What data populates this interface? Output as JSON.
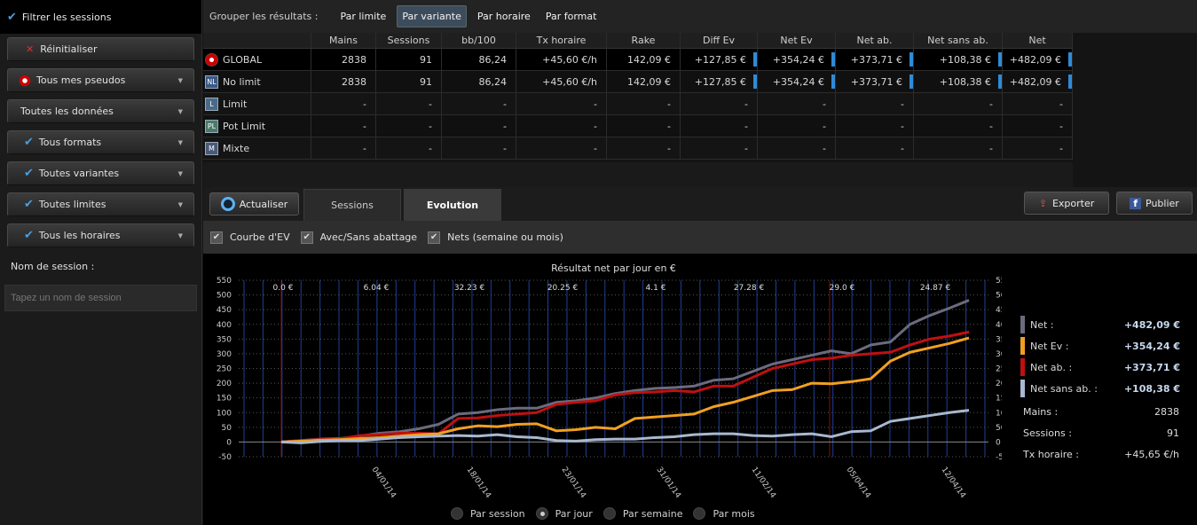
{
  "sidebar": {
    "header": "Filtrer les sessions",
    "reset": "Réinitialiser",
    "pseudos": "Tous mes pseudos",
    "data": "Toutes les données",
    "formats": "Tous formats",
    "variants": "Toutes variantes",
    "limits": "Toutes limites",
    "hours": "Tous les horaires",
    "session_name_label": "Nom de session :",
    "session_name_placeholder": "Tapez un nom de session"
  },
  "groupbar": {
    "label": "Grouper les résultats :",
    "items": [
      "Par limite",
      "Par variante",
      "Par horaire",
      "Par format"
    ],
    "active": "Par variante"
  },
  "table": {
    "headers": [
      "",
      "Mains",
      "Sessions",
      "bb/100",
      "Tx horaire",
      "Rake",
      "Diff Ev",
      "Net Ev",
      "Net ab.",
      "Net sans ab.",
      "Net"
    ],
    "rows": [
      {
        "badge": "",
        "name": "GLOBAL",
        "cells": [
          "2838",
          "91",
          "86,24",
          "+45,60 €/h",
          "142,09 €",
          "+127,85 €",
          "+354,24 €",
          "+373,71 €",
          "+108,38 €",
          "+482,09 €"
        ]
      },
      {
        "badge": "NL",
        "name": "No limit",
        "cells": [
          "2838",
          "91",
          "86,24",
          "+45,60 €/h",
          "142,09 €",
          "+127,85 €",
          "+354,24 €",
          "+373,71 €",
          "+108,38 €",
          "+482,09 €"
        ]
      },
      {
        "badge": "L",
        "name": "Limit",
        "cells": [
          "-",
          "-",
          "-",
          "-",
          "-",
          "-",
          "-",
          "-",
          "-",
          "-"
        ]
      },
      {
        "badge": "PL",
        "name": "Pot Limit",
        "cells": [
          "-",
          "-",
          "-",
          "-",
          "-",
          "-",
          "-",
          "-",
          "-",
          "-"
        ]
      },
      {
        "badge": "M",
        "name": "Mixte",
        "cells": [
          "-",
          "-",
          "-",
          "-",
          "-",
          "-",
          "-",
          "-",
          "-",
          "-"
        ]
      }
    ]
  },
  "toolbar": {
    "refresh": "Actualiser",
    "tab_sessions": "Sessions",
    "tab_evolution": "Evolution",
    "export": "Exporter",
    "publish": "Publier"
  },
  "options": [
    "Courbe d'EV",
    "Avec/Sans abattage",
    "Nets (semaine ou mois)"
  ],
  "legend": {
    "series": [
      {
        "name": "Net :",
        "value": "+482,09 €",
        "color": "#6b6b7e"
      },
      {
        "name": "Net Ev :",
        "value": "+354,24 €",
        "color": "#f0a020"
      },
      {
        "name": "Net ab. :",
        "value": "+373,71 €",
        "color": "#c01010"
      },
      {
        "name": "Net sans ab. :",
        "value": "+108,38 €",
        "color": "#a8b8d0"
      }
    ],
    "stats": [
      {
        "label": "Mains :",
        "value": "2838"
      },
      {
        "label": "Sessions :",
        "value": "91"
      },
      {
        "label": "Tx horaire :",
        "value": "+45,65 €/h"
      }
    ]
  },
  "radios": {
    "items": [
      "Par session",
      "Par jour",
      "Par semaine",
      "Par mois"
    ],
    "selected": "Par jour"
  },
  "chart_data": {
    "type": "line",
    "title": "Résultat net par jour en €",
    "ylim": [
      -50,
      550
    ],
    "y_ticks": [
      550,
      500,
      450,
      400,
      350,
      300,
      250,
      200,
      150,
      100,
      50,
      0,
      -50
    ],
    "x_tick_labels": [
      "04/01/14",
      "18/01/14",
      "23/01/14",
      "31/01/14",
      "11/02/14",
      "05/04/14",
      "12/04/14"
    ],
    "week_labels": [
      "0.0 €",
      "6.04 €",
      "32.23 €",
      "20.25 €",
      "4.1 €",
      "27.28 €",
      "29.0 €",
      "24.87 €"
    ],
    "series": [
      {
        "name": "Net",
        "color": "#6b6b7e",
        "values": [
          0,
          5,
          10,
          12,
          20,
          30,
          35,
          45,
          60,
          95,
          100,
          110,
          115,
          115,
          135,
          140,
          150,
          165,
          175,
          182,
          185,
          190,
          210,
          215,
          240,
          265,
          280,
          295,
          310,
          300,
          330,
          340,
          400,
          430,
          455,
          482
        ]
      },
      {
        "name": "Net ab.",
        "color": "#c01010",
        "values": [
          0,
          5,
          8,
          10,
          22,
          25,
          30,
          30,
          28,
          80,
          82,
          90,
          95,
          100,
          128,
          135,
          140,
          160,
          168,
          170,
          175,
          170,
          190,
          190,
          220,
          250,
          265,
          280,
          285,
          295,
          300,
          305,
          330,
          350,
          360,
          374
        ]
      },
      {
        "name": "Net Ev",
        "color": "#f0a020",
        "values": [
          0,
          3,
          6,
          8,
          12,
          15,
          20,
          25,
          28,
          45,
          55,
          52,
          60,
          62,
          38,
          42,
          50,
          45,
          80,
          85,
          90,
          95,
          120,
          135,
          155,
          175,
          178,
          200,
          198,
          205,
          215,
          275,
          305,
          320,
          335,
          354
        ]
      },
      {
        "name": "Net sans ab.",
        "color": "#a8b8d0",
        "values": [
          0,
          -3,
          2,
          5,
          5,
          10,
          15,
          18,
          20,
          22,
          20,
          25,
          18,
          15,
          5,
          3,
          8,
          10,
          10,
          15,
          18,
          25,
          28,
          28,
          22,
          20,
          25,
          28,
          18,
          35,
          38,
          70,
          80,
          90,
          100,
          108
        ]
      }
    ]
  }
}
